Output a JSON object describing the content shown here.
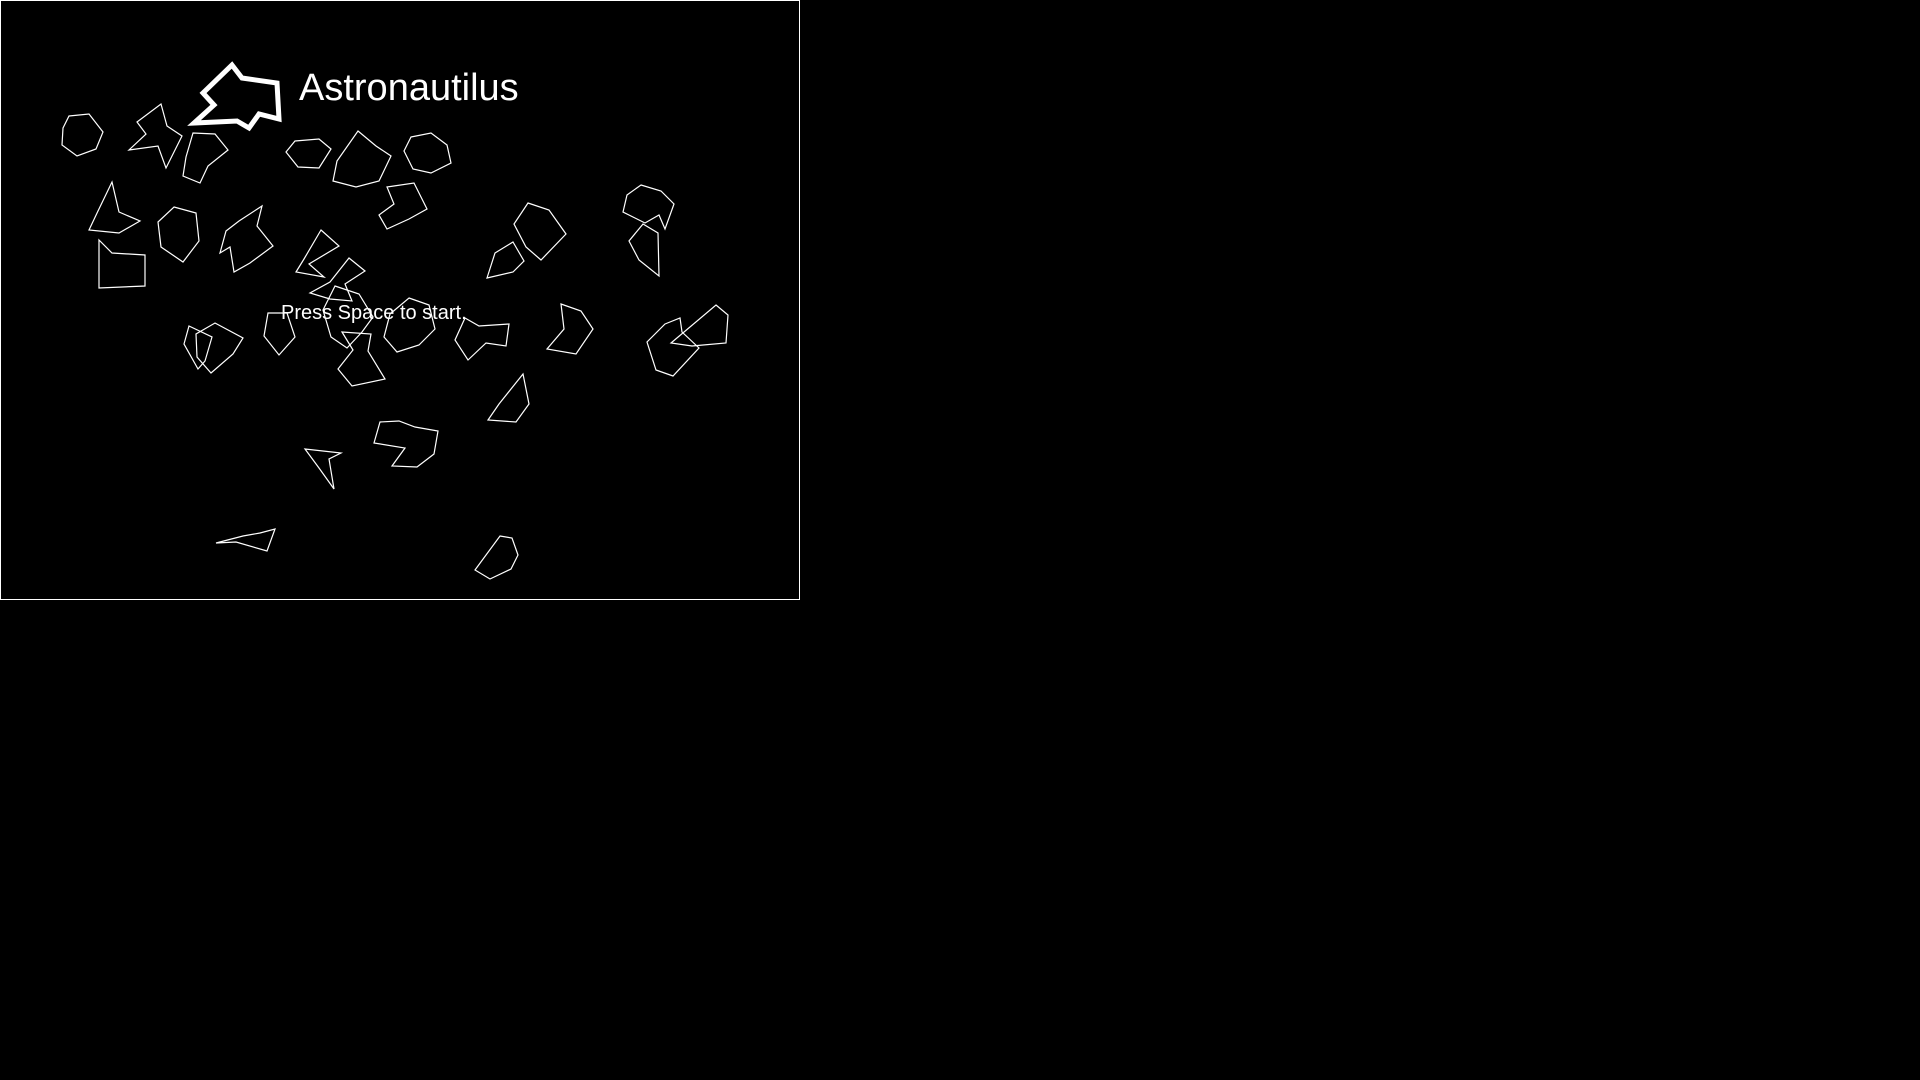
{
  "game": {
    "title": "Astronautilus",
    "prompt": "Press Space to start."
  },
  "colors": {
    "background": "#000000",
    "foreground": "#ffffff"
  },
  "icons": {
    "logo": "ship-logo-icon",
    "asteroid": "asteroid-outline-icon"
  }
}
